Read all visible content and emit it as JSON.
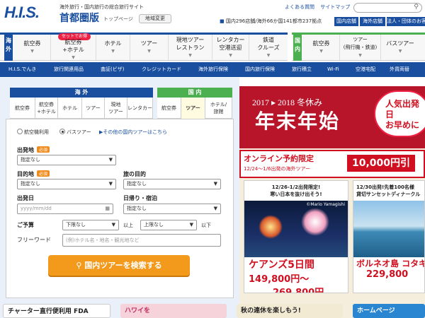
{
  "header": {
    "logo": "H.I.S.",
    "tagline": "海外旅行・国内旅行の総合旅行サイト",
    "region": "首都圏版",
    "toppage": "トップページ",
    "change_region": "地域変更",
    "links": [
      "よくある質問",
      "サイトマップ"
    ],
    "stores": "国内296店舗/海外66か国141都市237拠点",
    "right_tabs": [
      "国内店舗",
      "海外店舗",
      "法人・団体のお客様"
    ]
  },
  "nav": {
    "overseas_label": "海外",
    "domestic_label": "国内",
    "set_badge": "セットでお得",
    "overseas_items": [
      "航空券",
      "航空券\n+ホテル",
      "ホテル",
      "ツアー",
      "現地ツアー\nレストラン",
      "レンタカー\n空港送迎",
      "鉄道\nクルーズ"
    ],
    "domestic_items": [
      "航空券",
      "ツアー\n(飛行機・鉄道)",
      "バスツアー"
    ]
  },
  "bluebar": [
    "H.I.S.でんき",
    "旅行関連用品",
    "査証(ビザ)",
    "クレジットカード",
    "海外旅行保険",
    "国内旅行保険",
    "旅行積立",
    "Wi-Fi",
    "空港宅配",
    "外貨両替"
  ],
  "panel": {
    "tab_overseas": "海 外",
    "tab_domestic": "国 内",
    "overseas_subtabs": [
      "航空券",
      "航空券\n+ホテル",
      "ホテル",
      "ツアー",
      "現地\nツアー",
      "レンタカー"
    ],
    "domestic_subtabs": [
      "航空券",
      "ツアー",
      "ホテル/\n旅館"
    ],
    "radio_air": "航空機利用",
    "radio_bus": "バスツアー",
    "other_link": "▶その他の国内ツアーはこちら",
    "departure_label": "出発地",
    "required": "必須",
    "departure_value": "指定なし",
    "destination_label": "目的地",
    "destination_value": "指定なし",
    "purpose_label": "旅の目的",
    "purpose_value": "指定なし",
    "date_label": "出発日",
    "date_placeholder": "yyyy/mm/dd",
    "stay_label": "日帰り・宿泊",
    "stay_value": "指定なし",
    "budget_label": "ご予算",
    "budget_min": "下限なし",
    "budget_ijo": "以上",
    "budget_max": "上限なし",
    "budget_ika": "以下",
    "freeword_label": "フリーワード",
    "freeword_placeholder": "(例)ホテル名・地名・観光地など",
    "search_button": "国内ツアーを検索する"
  },
  "promo": {
    "season": "2017 ▸ 2018 冬休み",
    "title": "年末年始",
    "bubble": "人気出発日\nお早めに",
    "online_title": "オンライン予約限定",
    "online_sub": "12/24〜1/6出発の海外ツアー",
    "price_badge": "10,000円引",
    "card1_head": "12/26-1/2出発限定!\n寒い日本を抜け出そう!",
    "card1_credit": "©Mario Yamagishi",
    "card1_title": "ケアンズ5日間",
    "card1_price1": "149,800円〜",
    "card1_price2": "269,800円",
    "card2_head": "12/30出発!先着100名様\n貸切サンセットディナークル",
    "card2_title": "ボルネオ島 コタキナバル",
    "card2_price": "229,800"
  },
  "bottom": [
    "チャーター直行便利用 FDA",
    "ハワイを",
    "秋の連休を楽しもう!",
    "ホームページ"
  ],
  "colors": {
    "brand": "#1a4fa0",
    "domestic": "#4caf50",
    "accent": "#f39a1c",
    "promo_red": "#d01020"
  }
}
